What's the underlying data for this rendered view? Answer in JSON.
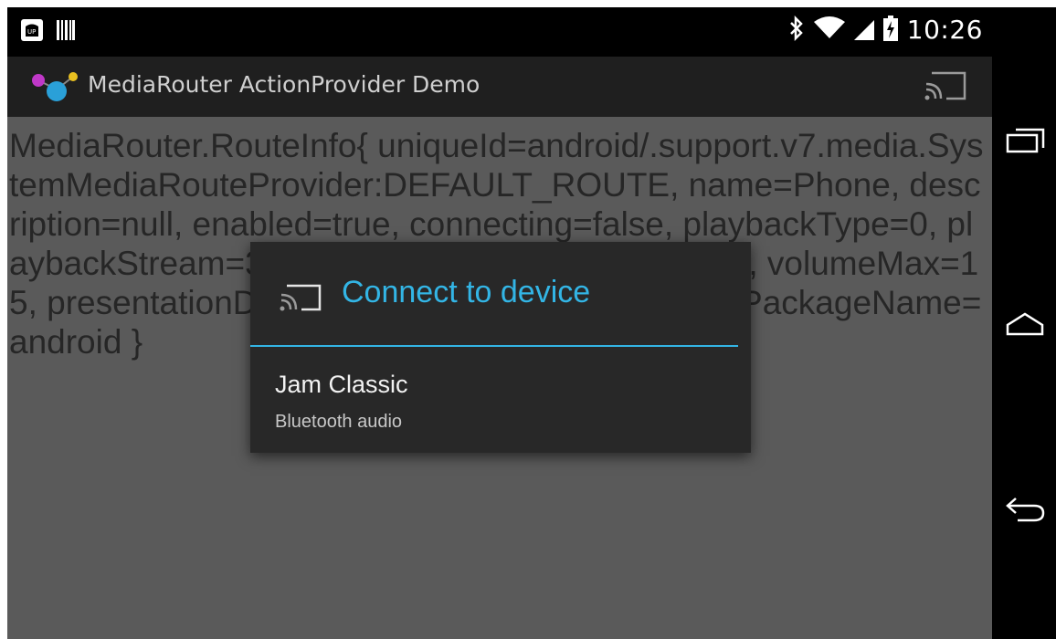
{
  "status_bar": {
    "time": "10:26",
    "left_icons": [
      "usb-debug-icon",
      "barcode-icon"
    ],
    "right_icons": [
      "bluetooth-icon",
      "wifi-icon",
      "signal-icon",
      "battery-charging-icon"
    ]
  },
  "action_bar": {
    "title": "MediaRouter ActionProvider Demo",
    "icons": [
      "app-logo-icon",
      "cast-icon"
    ]
  },
  "content": {
    "text": "MediaRouter.RouteInfo{ uniqueId=android/.support.v7.media.SystemMediaRouteProvider:DEFAULT_ROUTE, name=Phone, description=null, enabled=true, connecting=false, playbackType=0, playbackStream=3, volumeHandling=1, volume=10, volumeMax=15, presentationDisplay=null, extras=null, providerPackageName=android }"
  },
  "dialog": {
    "title": "Connect to device",
    "routes": [
      {
        "name": "Jam Classic",
        "description": "Bluetooth audio"
      }
    ]
  },
  "nav_bar": {
    "icons": [
      "recent-apps-icon",
      "home-icon",
      "back-icon"
    ]
  },
  "colors": {
    "accent": "#33b5e5",
    "content_dimmed": "#5a5a5a",
    "dialog_bg": "#282828",
    "action_bar_bg": "#1f1f1f"
  }
}
